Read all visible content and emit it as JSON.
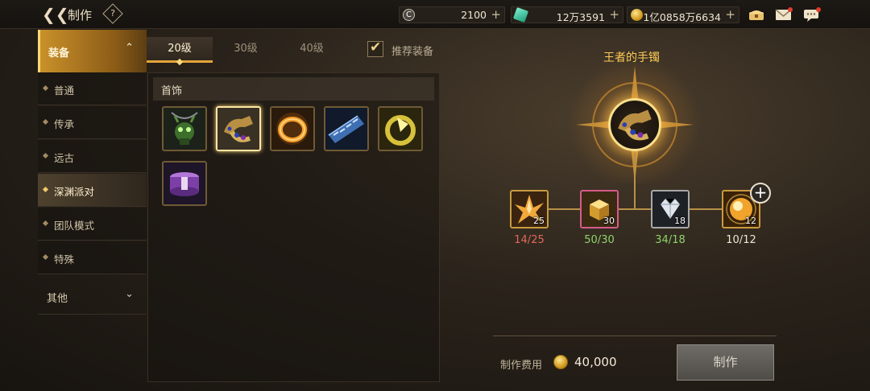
{
  "header": {
    "title": "制作",
    "help_label": "?",
    "currencies": [
      {
        "icon": "c-coin-icon",
        "value": "2100"
      },
      {
        "icon": "crystal-icon",
        "value": "12万3591"
      },
      {
        "icon": "gold-coin-icon",
        "value": "1亿0858万6634"
      }
    ],
    "plus": "+",
    "icons": [
      "treasure-chest-icon",
      "mail-icon",
      "chat-icon"
    ]
  },
  "sidebar": {
    "category": "装备",
    "items": [
      {
        "label": "普通"
      },
      {
        "label": "传承"
      },
      {
        "label": "远古"
      },
      {
        "label": "深渊派对"
      },
      {
        "label": "团队模式"
      },
      {
        "label": "特殊"
      }
    ],
    "active_index": 3,
    "other": "其他"
  },
  "tabs": [
    {
      "label": "20级"
    },
    {
      "label": "30级"
    },
    {
      "label": "40级"
    }
  ],
  "recommend": {
    "label": "推荐装备",
    "checked": true
  },
  "panel": {
    "section_title": "首饰",
    "items": [
      "green-goblin-necklace-icon",
      "gold-bracelet-icon",
      "orange-ring-icon",
      "blue-band-icon",
      "gold-arrow-ring-icon",
      "purple-bracelet-icon"
    ],
    "selected_index": 1
  },
  "detail": {
    "item_name": "王者的手镯",
    "materials": [
      {
        "icon": "gold-crystal-cluster-icon",
        "count": "25",
        "have": "14/25",
        "enough": false
      },
      {
        "icon": "gold-cubes-icon",
        "count": "30",
        "have": "50/30",
        "enough": true
      },
      {
        "icon": "diamond-icon",
        "count": "18",
        "have": "34/18",
        "enough": true
      },
      {
        "icon": "golden-orb-icon",
        "count": "12",
        "have": "10/12",
        "enough": false
      }
    ],
    "add_label": "+"
  },
  "footer": {
    "cost_label": "制作费用",
    "cost_value": "40,000",
    "make_button": "制作"
  },
  "colors": {
    "accent": "#e5a43a",
    "name": "#ffcb57",
    "insufficient": "#e06a5a",
    "sufficient": "#8fd36a"
  }
}
